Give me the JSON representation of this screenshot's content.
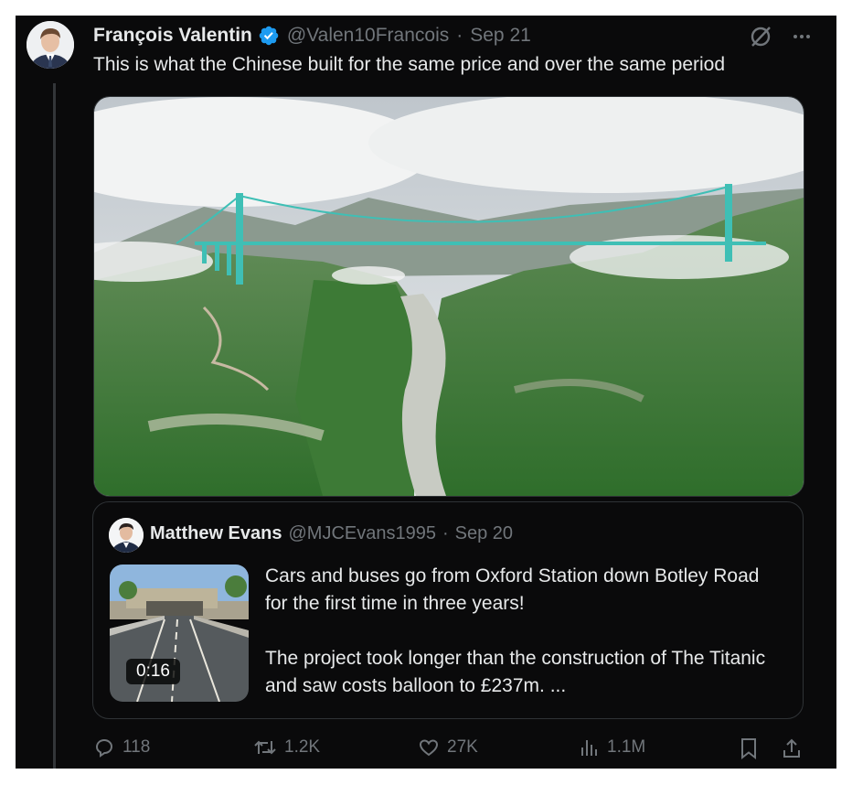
{
  "post": {
    "author": {
      "name": "François Valentin",
      "handle": "@Valen10Francois",
      "date": "Sep 21",
      "verified": true
    },
    "text": "This is what the Chinese built for the same price and over the same period",
    "icons": {
      "grok": "grok-icon",
      "more": "more-icon"
    },
    "image": {
      "subject": "suspension-bridge-over-canyon"
    }
  },
  "quote": {
    "author": {
      "name": "Matthew Evans",
      "handle": "@MJCEvans1995",
      "date": "Sep 20"
    },
    "video_duration": "0:16",
    "paragraphs": [
      "Cars and buses go from Oxford Station down Botley Road for the first time in three years!",
      "The project took longer than the construction of The Titanic and saw costs balloon to £237m. ..."
    ]
  },
  "actions": {
    "replies": "118",
    "reposts": "1.2K",
    "likes": "27K",
    "views": "1.1M"
  },
  "colors": {
    "background": "#0a0a0b",
    "text": "#e7e9ea",
    "muted": "#71767b",
    "verified": "#1d9bf0",
    "border": "#2f3336"
  }
}
